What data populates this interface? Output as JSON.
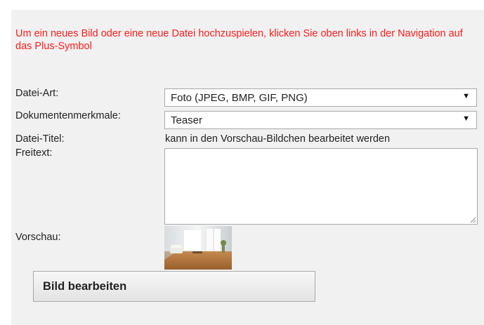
{
  "notice": "Um ein neues Bild oder eine neue Datei hochzuspielen, klicken Sie oben links in der Navigation auf das Plus-Symbol",
  "form": {
    "file_type": {
      "label": "Datei-Art:",
      "value": "Foto (JPEG, BMP, GIF, PNG)"
    },
    "document_features": {
      "label": "Dokumentenmerkmale:",
      "value": "Teaser"
    },
    "file_title": {
      "label": "Datei-Titel:",
      "value": "kann in den Vorschau-Bildchen bearbeitet werden"
    },
    "free_text": {
      "label": "Freitext:",
      "value": ""
    },
    "preview": {
      "label": "Vorschau:",
      "image": "living-room-photo-thumbnail"
    }
  },
  "edit_button_label": "Bild bearbeiten",
  "icons": {
    "dropdown": "dropdown-arrow-icon",
    "resize": "resize-grip-icon"
  },
  "colors": {
    "notice": "#ff1a1a",
    "panel_background": "#f1f1f1"
  }
}
